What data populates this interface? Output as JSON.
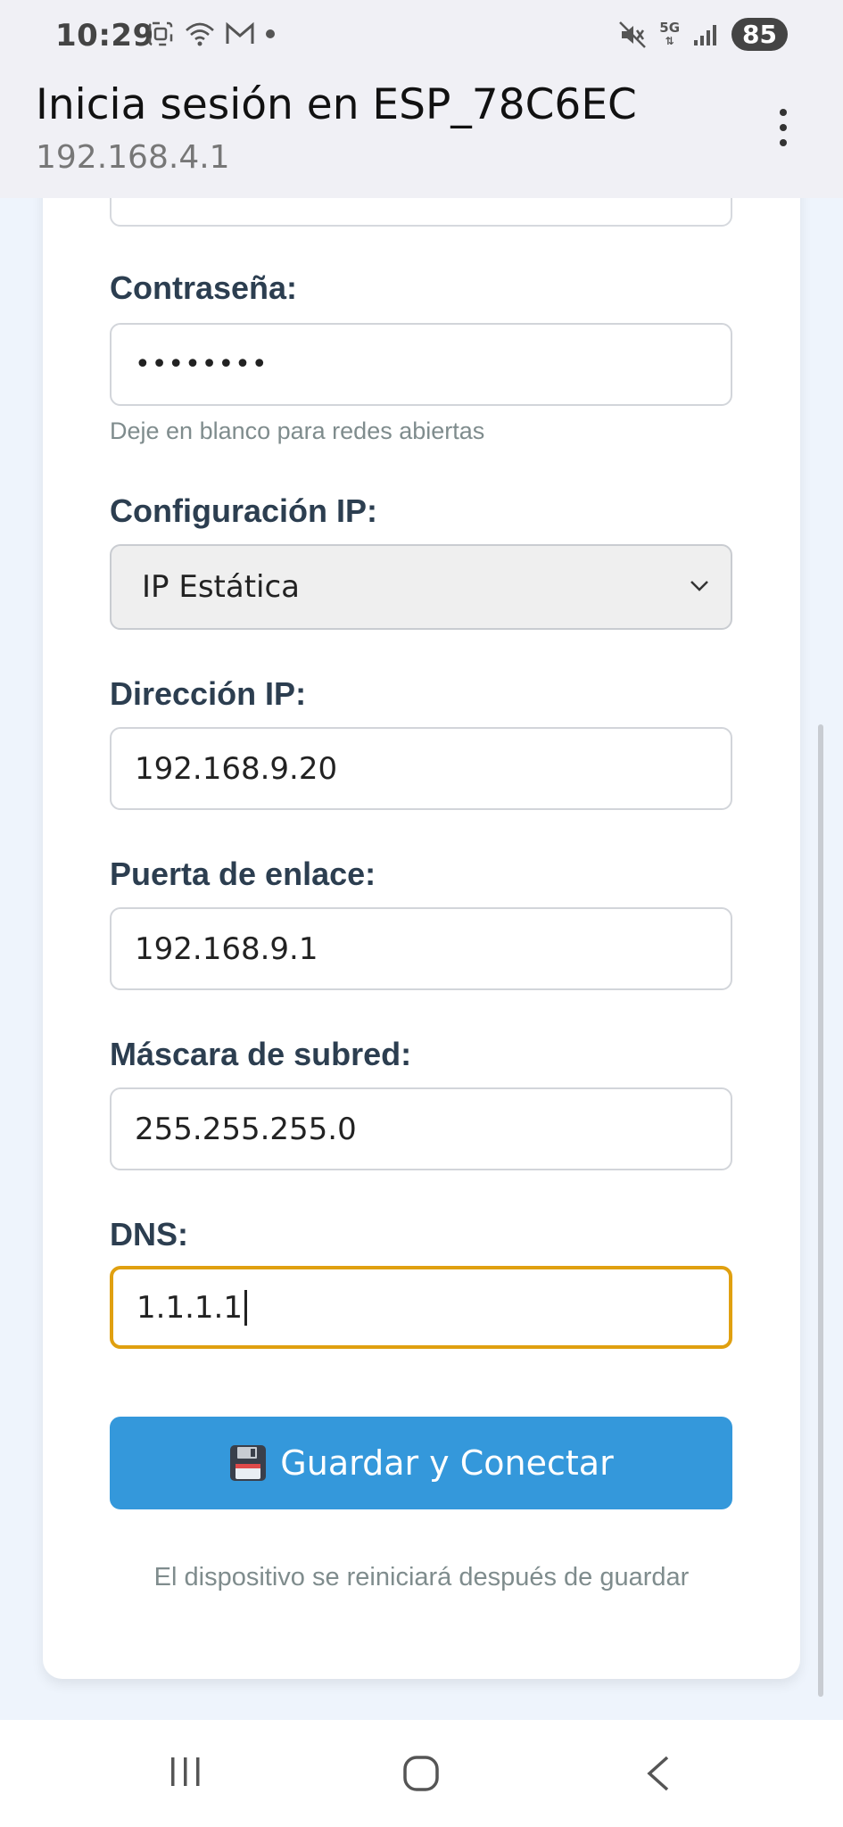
{
  "status_bar": {
    "time": "10:29",
    "battery": "85",
    "network": "5G",
    "left_icons": [
      "screenshot-icon",
      "wifi-icon",
      "gmail-icon",
      "dot-icon"
    ],
    "right_icons": [
      "mute-icon",
      "network-5g-icon",
      "signal-icon"
    ]
  },
  "app_bar": {
    "title": "Inicia sesión en ESP_78C6EC",
    "subtitle": "192.168.4.1"
  },
  "form": {
    "password_label": "Contraseña:",
    "password_value": "••••••••",
    "password_hint": "Deje en blanco para redes abiertas",
    "ip_config_label": "Configuración IP:",
    "ip_config_value": "IP Estática",
    "ip_label": "Dirección IP:",
    "ip_value": "192.168.9.20",
    "gateway_label": "Puerta de enlace:",
    "gateway_value": "192.168.9.1",
    "mask_label": "Máscara de subred:",
    "mask_value": "255.255.255.0",
    "dns_label": "DNS:",
    "dns_value": "1.1.1.1",
    "submit_label": "Guardar y Conectar",
    "footer_note": "El dispositivo se reiniciará después de guardar"
  },
  "colors": {
    "accent": "#3498db",
    "focus": "#e0a010",
    "label": "#2c3e50",
    "hint": "#7f8c8d"
  }
}
